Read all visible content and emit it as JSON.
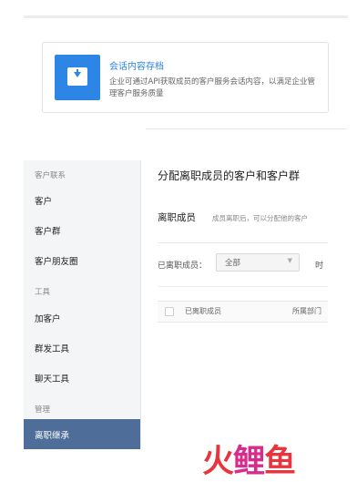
{
  "card": {
    "title": "会话内容存档",
    "description": "企业可通过API获取成员的客户服务会话内容，以满足企业管理客户服务质量",
    "icon": "download-icon",
    "accent_color": "#2d86e5"
  },
  "sidebar": {
    "groups": [
      "客户联系",
      "工具",
      "管理"
    ],
    "items": [
      "客户",
      "客户群",
      "客户朋友圈",
      "加客户",
      "群发工具",
      "聊天工具",
      "离职继承"
    ],
    "active_item": "离职继承",
    "active_color": "#4f6d99"
  },
  "main": {
    "title": "分配离职成员的客户和客户群",
    "section_title": "离职成员",
    "section_subtitle": "成员离职后，可以分配他的客户",
    "filter_label": "已离职成员：",
    "filter_value": "全部",
    "filter_next_label": "时",
    "table_headers": [
      "已离职成员",
      "所属部门"
    ]
  },
  "watermark_logo": {
    "text1": "火",
    "text2": "鲤",
    "text3": "鱼"
  }
}
